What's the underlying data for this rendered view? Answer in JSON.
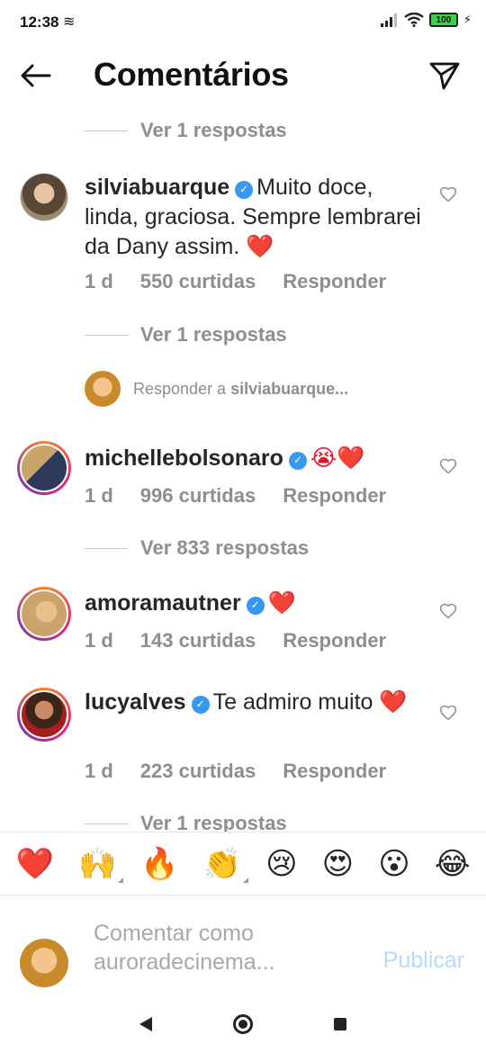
{
  "status_bar": {
    "time": "12:38",
    "battery": "100"
  },
  "header": {
    "title": "Comentários"
  },
  "view_replies": [
    {
      "label": "Ver 1 respostas"
    },
    {
      "label": "Ver 1 respostas"
    },
    {
      "label": "Ver 833 respostas"
    },
    {
      "label": "Ver 1 respostas"
    }
  ],
  "comments": [
    {
      "username": "silviabuarque",
      "text": "Muito doce, linda, graciosa.  Sempre lembrarei da Dany assim.",
      "emoji": "❤️",
      "time": "1 d",
      "likes": "550 curtidas",
      "reply_label": "Responder"
    },
    {
      "username": "michellebolsonaro",
      "text": "",
      "emoji": "😭❤️",
      "time": "1 d",
      "likes": "996 curtidas",
      "reply_label": "Responder"
    },
    {
      "username": "amoramautner",
      "text": "",
      "emoji": "❤️",
      "time": "1 d",
      "likes": "143 curtidas",
      "reply_label": "Responder"
    },
    {
      "username": "lucyalves",
      "text": "Te admiro muito",
      "emoji": "❤️",
      "time": "1 d",
      "likes": "223 curtidas",
      "reply_label": "Responder"
    }
  ],
  "reply_to": {
    "prefix": "Responder a",
    "username": "silviabuarque..."
  },
  "emoji_bar": [
    "❤️",
    "🙌",
    "🔥",
    "👏",
    "😢",
    "😍",
    "😮",
    "😂"
  ],
  "compose": {
    "placeholder": "Comentar como auroradecinema...",
    "publish_label": "Publicar"
  },
  "colors": {
    "verified": "#3897f0",
    "muted": "#8e8e8e",
    "publish_disabled": "#b3dbff",
    "heart": "#e0162b"
  }
}
